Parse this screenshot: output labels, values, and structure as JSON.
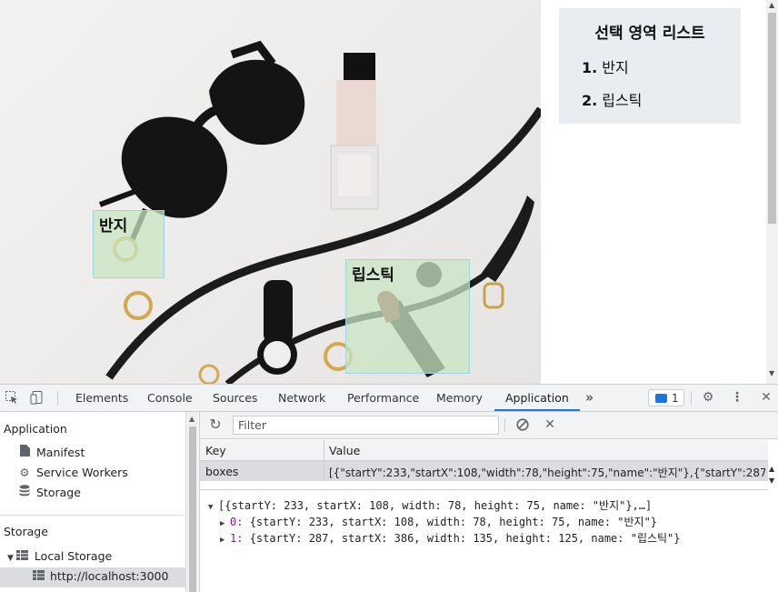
{
  "boxes": [
    {
      "label": "반지"
    },
    {
      "label": "립스틱"
    }
  ],
  "list_panel": {
    "title": "선택 영역 리스트",
    "items": [
      {
        "num": "1.",
        "label": "반지"
      },
      {
        "num": "2.",
        "label": "립스틱"
      }
    ]
  },
  "devtools": {
    "tabs": [
      "Elements",
      "Console",
      "Sources",
      "Network",
      "Performance",
      "Memory",
      "Application"
    ],
    "active_tab": "Application",
    "more_tabs_glyph": "»",
    "message_count": "1",
    "sidebar": {
      "application_header": "Application",
      "application_items": [
        "Manifest",
        "Service Workers",
        "Storage"
      ],
      "storage_header": "Storage",
      "local_storage_label": "Local Storage",
      "local_storage_origin": "http://localhost:3000"
    },
    "filter_placeholder": "Filter",
    "table": {
      "key_header": "Key",
      "value_header": "Value",
      "row_key": "boxes",
      "row_value": "[{\"startY\":233,\"startX\":108,\"width\":78,\"height\":75,\"name\":\"반지\"},{\"startY\":287,\"sta..."
    },
    "preview": {
      "root": "[{startY: 233, startX: 108, width: 78, height: 75, name: \"반지\"},…]",
      "items": [
        {
          "index": "0:",
          "text": "{startY: 233, startX: 108, width: 78, height: 75, name: \"반지\"}"
        },
        {
          "index": "1:",
          "text": "{startY: 287, startX: 386, width: 135, height: 125, name: \"립스틱\"}"
        }
      ]
    }
  }
}
